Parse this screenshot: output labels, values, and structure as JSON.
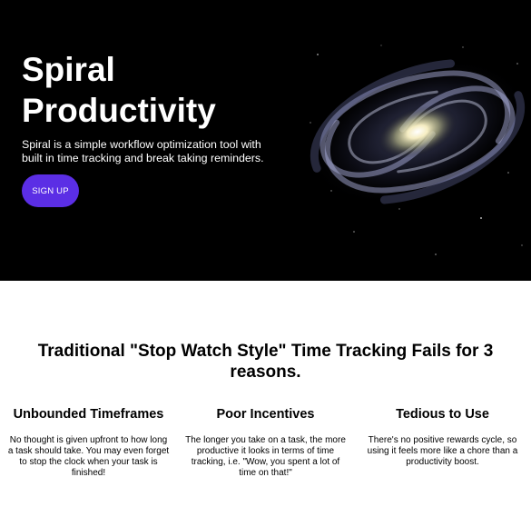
{
  "hero": {
    "title": "Spiral Productivity",
    "description": "Spiral is a simple workflow optimization tool with built in time tracking and break taking reminders.",
    "signup_label": "SIGN UP",
    "accent_color": "#5b2ee5",
    "background_color": "#000000"
  },
  "reasons": {
    "heading": "Traditional \"Stop Watch Style\" Time Tracking Fails for 3 reasons.",
    "items": [
      {
        "title": "Unbounded Timeframes",
        "text": "No thought is given upfront to how long a task should take. You may even forget to stop the clock when your task is finished!"
      },
      {
        "title": "Poor Incentives",
        "text": "The longer you take on a task, the more productive it looks in terms of time tracking, i.e. \"Wow, you spent a lot of time on that!\""
      },
      {
        "title": "Tedious to Use",
        "text": "There's no positive rewards cycle, so using it feels more like a chore than a productivity boost."
      }
    ]
  }
}
